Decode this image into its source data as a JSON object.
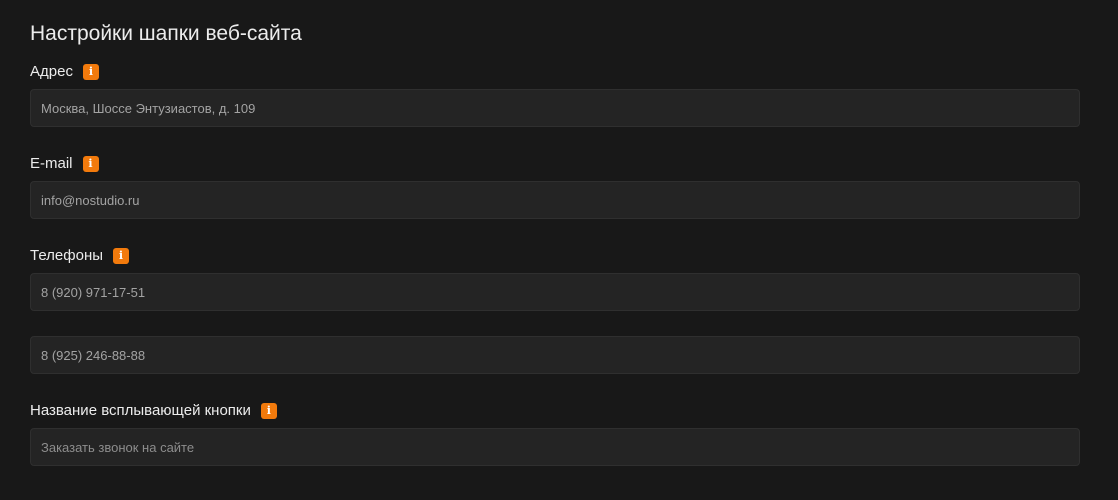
{
  "page": {
    "title": "Настройки шапки веб-сайта"
  },
  "fields": {
    "address": {
      "label": "Адрес",
      "value": "Москва, Шоссе Энтузиастов, д. 109",
      "info_icon": "info-icon"
    },
    "email": {
      "label": "E-mail",
      "value": "info@nostudio.ru",
      "info_icon": "info-icon"
    },
    "phones": {
      "label": "Телефоны",
      "values": [
        "8 (920) 971-17-51",
        "8 (925) 246-88-88"
      ],
      "info_icon": "info-icon"
    },
    "popup_button": {
      "label": "Название всплывающей кнопки",
      "placeholder": "Заказать звонок на сайте",
      "info_icon": "info-icon"
    }
  },
  "colors": {
    "background": "#181818",
    "input_background": "#242424",
    "accent": "#f27a0c",
    "text": "#ececec",
    "input_text": "#a3a3a3"
  },
  "icons": {
    "info_glyph": "i"
  }
}
